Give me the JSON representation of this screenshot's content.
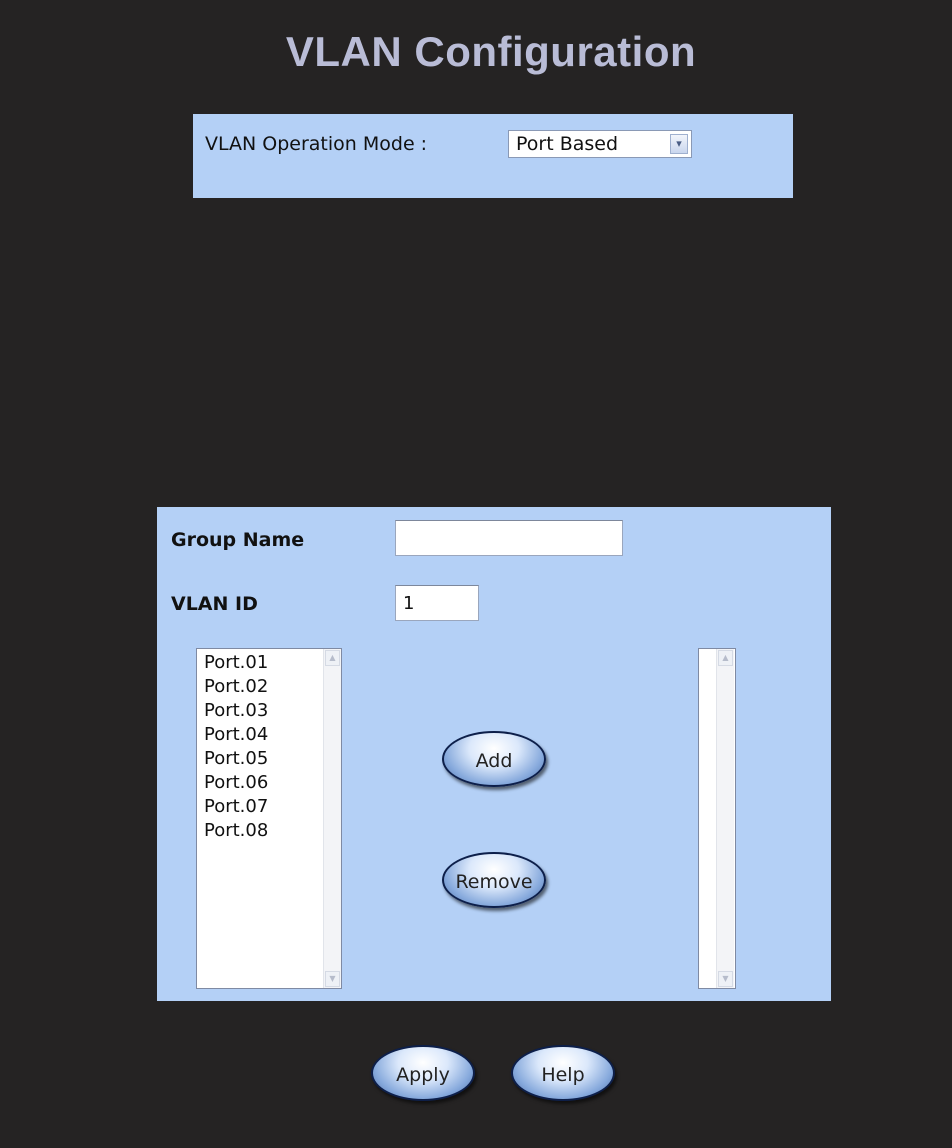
{
  "page": {
    "title": "VLAN Configuration"
  },
  "mode": {
    "label": "VLAN Operation Mode :",
    "selected": "Port Based",
    "arrow": "▾"
  },
  "form": {
    "group_name_label": "Group Name",
    "group_name_value": "",
    "vlan_id_label": "VLAN ID",
    "vlan_id_value": "1"
  },
  "ports": [
    "Port.01",
    "Port.02",
    "Port.03",
    "Port.04",
    "Port.05",
    "Port.06",
    "Port.07",
    "Port.08"
  ],
  "members": [],
  "buttons": {
    "add": "Add",
    "remove": "Remove",
    "apply": "Apply",
    "help": "Help"
  },
  "icons": {
    "scroll_up": "▲",
    "scroll_down": "▼"
  }
}
